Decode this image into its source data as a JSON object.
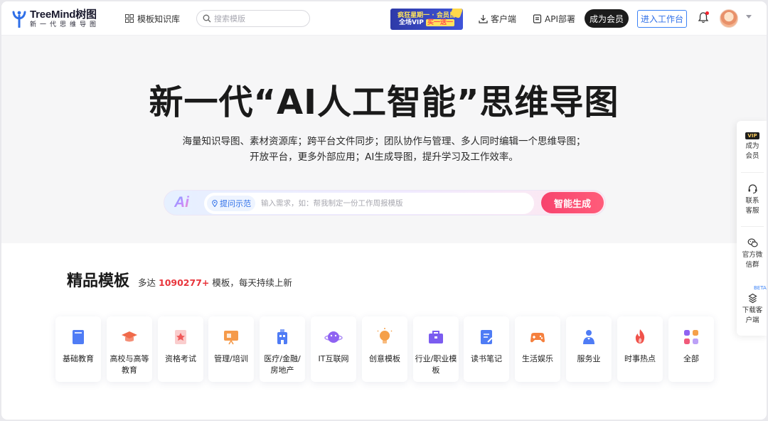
{
  "header": {
    "logo_name": "TreeMind树图",
    "logo_slogan": "新一代思维导图",
    "nav_templates": "模板知识库",
    "search_placeholder": "搜索模版",
    "promo": {
      "line1": "疯狂星期一 · 会员日",
      "line2_a": "全场VIP",
      "line2_b": "买一送一"
    },
    "client_label": "客户端",
    "api_label": "API部署",
    "vip_button": "成为会员",
    "workspace_button": "进入工作台"
  },
  "hero": {
    "title": "新一代“AI人工智能”思维导图",
    "subtitle_line1": "海量知识导图、素材资源库；跨平台文件同步；团队协作与管理、多人同时编辑一个思维导图；",
    "subtitle_line2": "开放平台，更多外部应用；AI生成导图，提升学习及工作效率。",
    "ai_logo": "Ai",
    "ai_chip": "提问示范",
    "ai_placeholder": "输入需求，如：帮我制定一份工作周报模版",
    "ai_button": "智能生成"
  },
  "templates": {
    "title": "精品模板",
    "desc_prefix": "多达",
    "count": "1090277+",
    "desc_suffix": "模板，每天持续上新",
    "categories": [
      {
        "label": "基础教育",
        "icon": "book-icon",
        "color": "#4f7cf5"
      },
      {
        "label": "高校与高等教育",
        "icon": "graduation-cap-icon",
        "color": "#f06a4a"
      },
      {
        "label": "资格考试",
        "icon": "certificate-icon",
        "color": "#f05a5a"
      },
      {
        "label": "管理/培训",
        "icon": "presentation-icon",
        "color": "#f59a4a"
      },
      {
        "label": "医疗/金融/房地产",
        "icon": "building-icon",
        "color": "#4f7cf5"
      },
      {
        "label": "IT互联网",
        "icon": "planet-icon",
        "color": "#8f63f2"
      },
      {
        "label": "创意模板",
        "icon": "lightbulb-icon",
        "color": "#f5a04a"
      },
      {
        "label": "行业/职业模板",
        "icon": "briefcase-icon",
        "color": "#7b5cf0"
      },
      {
        "label": "读书笔记",
        "icon": "notes-icon",
        "color": "#4f7cf5"
      },
      {
        "label": "生活娱乐",
        "icon": "gamepad-icon",
        "color": "#f5803e"
      },
      {
        "label": "服务业",
        "icon": "service-icon",
        "color": "#4f7cf5"
      },
      {
        "label": "时事热点",
        "icon": "fire-icon",
        "color": "#f0524a"
      },
      {
        "label": "全部",
        "icon": "all-apps-icon",
        "color": "#8f63f2"
      }
    ]
  },
  "float_bar": {
    "vip_tag": "VIP",
    "become_vip": "成为会员",
    "support": "联系客服",
    "wechat_group": "官方微信群",
    "beta": "BETA",
    "download": "下载客户端"
  }
}
